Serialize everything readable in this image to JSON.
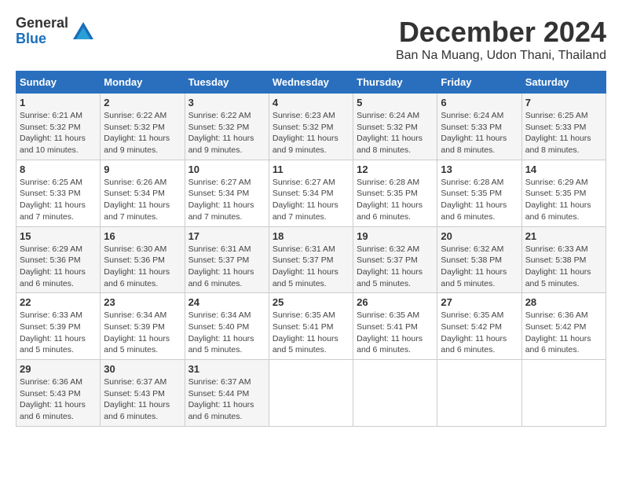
{
  "logo": {
    "general": "General",
    "blue": "Blue"
  },
  "title": "December 2024",
  "location": "Ban Na Muang, Udon Thani, Thailand",
  "days_of_week": [
    "Sunday",
    "Monday",
    "Tuesday",
    "Wednesday",
    "Thursday",
    "Friday",
    "Saturday"
  ],
  "weeks": [
    [
      {
        "day": 1,
        "sunrise": "6:21 AM",
        "sunset": "5:32 PM",
        "daylight": "11 hours and 10 minutes."
      },
      {
        "day": 2,
        "sunrise": "6:22 AM",
        "sunset": "5:32 PM",
        "daylight": "11 hours and 9 minutes."
      },
      {
        "day": 3,
        "sunrise": "6:22 AM",
        "sunset": "5:32 PM",
        "daylight": "11 hours and 9 minutes."
      },
      {
        "day": 4,
        "sunrise": "6:23 AM",
        "sunset": "5:32 PM",
        "daylight": "11 hours and 9 minutes."
      },
      {
        "day": 5,
        "sunrise": "6:24 AM",
        "sunset": "5:32 PM",
        "daylight": "11 hours and 8 minutes."
      },
      {
        "day": 6,
        "sunrise": "6:24 AM",
        "sunset": "5:33 PM",
        "daylight": "11 hours and 8 minutes."
      },
      {
        "day": 7,
        "sunrise": "6:25 AM",
        "sunset": "5:33 PM",
        "daylight": "11 hours and 8 minutes."
      }
    ],
    [
      {
        "day": 8,
        "sunrise": "6:25 AM",
        "sunset": "5:33 PM",
        "daylight": "11 hours and 7 minutes."
      },
      {
        "day": 9,
        "sunrise": "6:26 AM",
        "sunset": "5:34 PM",
        "daylight": "11 hours and 7 minutes."
      },
      {
        "day": 10,
        "sunrise": "6:27 AM",
        "sunset": "5:34 PM",
        "daylight": "11 hours and 7 minutes."
      },
      {
        "day": 11,
        "sunrise": "6:27 AM",
        "sunset": "5:34 PM",
        "daylight": "11 hours and 7 minutes."
      },
      {
        "day": 12,
        "sunrise": "6:28 AM",
        "sunset": "5:35 PM",
        "daylight": "11 hours and 6 minutes."
      },
      {
        "day": 13,
        "sunrise": "6:28 AM",
        "sunset": "5:35 PM",
        "daylight": "11 hours and 6 minutes."
      },
      {
        "day": 14,
        "sunrise": "6:29 AM",
        "sunset": "5:35 PM",
        "daylight": "11 hours and 6 minutes."
      }
    ],
    [
      {
        "day": 15,
        "sunrise": "6:29 AM",
        "sunset": "5:36 PM",
        "daylight": "11 hours and 6 minutes."
      },
      {
        "day": 16,
        "sunrise": "6:30 AM",
        "sunset": "5:36 PM",
        "daylight": "11 hours and 6 minutes."
      },
      {
        "day": 17,
        "sunrise": "6:31 AM",
        "sunset": "5:37 PM",
        "daylight": "11 hours and 6 minutes."
      },
      {
        "day": 18,
        "sunrise": "6:31 AM",
        "sunset": "5:37 PM",
        "daylight": "11 hours and 5 minutes."
      },
      {
        "day": 19,
        "sunrise": "6:32 AM",
        "sunset": "5:37 PM",
        "daylight": "11 hours and 5 minutes."
      },
      {
        "day": 20,
        "sunrise": "6:32 AM",
        "sunset": "5:38 PM",
        "daylight": "11 hours and 5 minutes."
      },
      {
        "day": 21,
        "sunrise": "6:33 AM",
        "sunset": "5:38 PM",
        "daylight": "11 hours and 5 minutes."
      }
    ],
    [
      {
        "day": 22,
        "sunrise": "6:33 AM",
        "sunset": "5:39 PM",
        "daylight": "11 hours and 5 minutes."
      },
      {
        "day": 23,
        "sunrise": "6:34 AM",
        "sunset": "5:39 PM",
        "daylight": "11 hours and 5 minutes."
      },
      {
        "day": 24,
        "sunrise": "6:34 AM",
        "sunset": "5:40 PM",
        "daylight": "11 hours and 5 minutes."
      },
      {
        "day": 25,
        "sunrise": "6:35 AM",
        "sunset": "5:41 PM",
        "daylight": "11 hours and 5 minutes."
      },
      {
        "day": 26,
        "sunrise": "6:35 AM",
        "sunset": "5:41 PM",
        "daylight": "11 hours and 6 minutes."
      },
      {
        "day": 27,
        "sunrise": "6:35 AM",
        "sunset": "5:42 PM",
        "daylight": "11 hours and 6 minutes."
      },
      {
        "day": 28,
        "sunrise": "6:36 AM",
        "sunset": "5:42 PM",
        "daylight": "11 hours and 6 minutes."
      }
    ],
    [
      {
        "day": 29,
        "sunrise": "6:36 AM",
        "sunset": "5:43 PM",
        "daylight": "11 hours and 6 minutes."
      },
      {
        "day": 30,
        "sunrise": "6:37 AM",
        "sunset": "5:43 PM",
        "daylight": "11 hours and 6 minutes."
      },
      {
        "day": 31,
        "sunrise": "6:37 AM",
        "sunset": "5:44 PM",
        "daylight": "11 hours and 6 minutes."
      },
      null,
      null,
      null,
      null
    ]
  ]
}
